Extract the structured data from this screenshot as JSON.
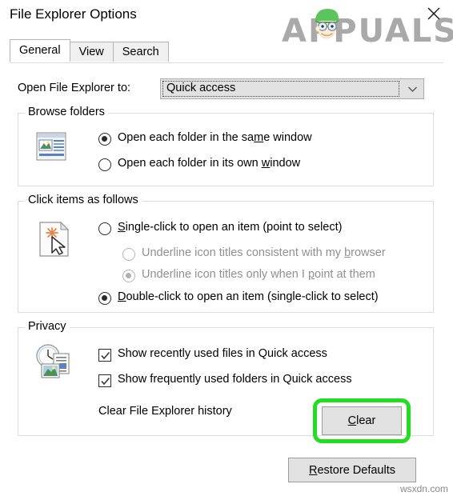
{
  "window": {
    "title": "File Explorer Options",
    "close_icon": "close-x-icon"
  },
  "brand": {
    "text": "APPUALS",
    "mascot_icon": "appuals-mascot-icon",
    "color": "#a9a9a9"
  },
  "tabs": [
    {
      "label": "General",
      "active": true
    },
    {
      "label": "View",
      "active": false
    },
    {
      "label": "Search",
      "active": false
    }
  ],
  "general": {
    "open_to": {
      "label": "Open File Explorer to:",
      "value": "Quick access",
      "chevron_icon": "chevron-down-icon"
    },
    "browse_folders": {
      "legend": "Browse folders",
      "icon": "folder-window-icon",
      "options": [
        {
          "pre": "Open each folder in the sa",
          "accel": "m",
          "post": "e window",
          "selected": true,
          "disabled": false
        },
        {
          "pre": "Open each folder in its own ",
          "accel": "w",
          "post": "indow",
          "selected": false,
          "disabled": false
        }
      ]
    },
    "click_items": {
      "legend": "Click items as follows",
      "icon": "page-cursor-icon",
      "options": [
        {
          "pre": "",
          "accel": "S",
          "post": "ingle-click to open an item (point to select)",
          "selected": false,
          "disabled": false
        },
        {
          "pre": "Underline icon titles consistent with my ",
          "accel": "b",
          "post": "rowser",
          "selected": false,
          "disabled": true,
          "indented": true
        },
        {
          "pre": "Underline icon titles only when I ",
          "accel": "p",
          "post": "oint at them",
          "selected": true,
          "disabled": true,
          "indented": true
        },
        {
          "pre": "",
          "accel": "D",
          "post": "ouble-click to open an item (single-click to select)",
          "selected": true,
          "disabled": false
        }
      ]
    },
    "privacy": {
      "legend": "Privacy",
      "icon": "clock-documents-icon",
      "checkboxes": [
        {
          "label": "Show recently used files in Quick access",
          "checked": true
        },
        {
          "label": "Show frequently used folders in Quick access",
          "checked": true
        }
      ],
      "history_label": "Clear File Explorer history",
      "clear_button": {
        "accel": "C",
        "post": "lear",
        "highlighted": true
      }
    },
    "restore_defaults_button": {
      "accel": "R",
      "post": "estore Defaults"
    }
  },
  "annotations": {
    "highlight_color": "#22dd22"
  },
  "footer": {
    "site_watermark": "wsxdn.com"
  }
}
